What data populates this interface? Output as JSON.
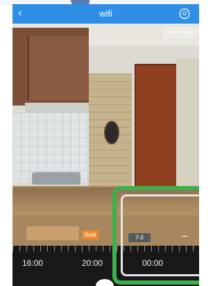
{
  "header": {
    "back_icon": "‹",
    "title": "wifi",
    "settings_icon": "gear-icon"
  },
  "video": {
    "speed": "↓84 KB/S"
  },
  "timeline": {
    "live_label": "Real",
    "date_label": "7-3",
    "times": [
      "16:00",
      "20:00",
      "00:00"
    ]
  },
  "highlight": {
    "mark": "I"
  },
  "colors": {
    "header": "#2f8fe6",
    "live_badge": "#f08a2c",
    "highlight": "#3db04b",
    "timeline_bg": "#181818"
  }
}
